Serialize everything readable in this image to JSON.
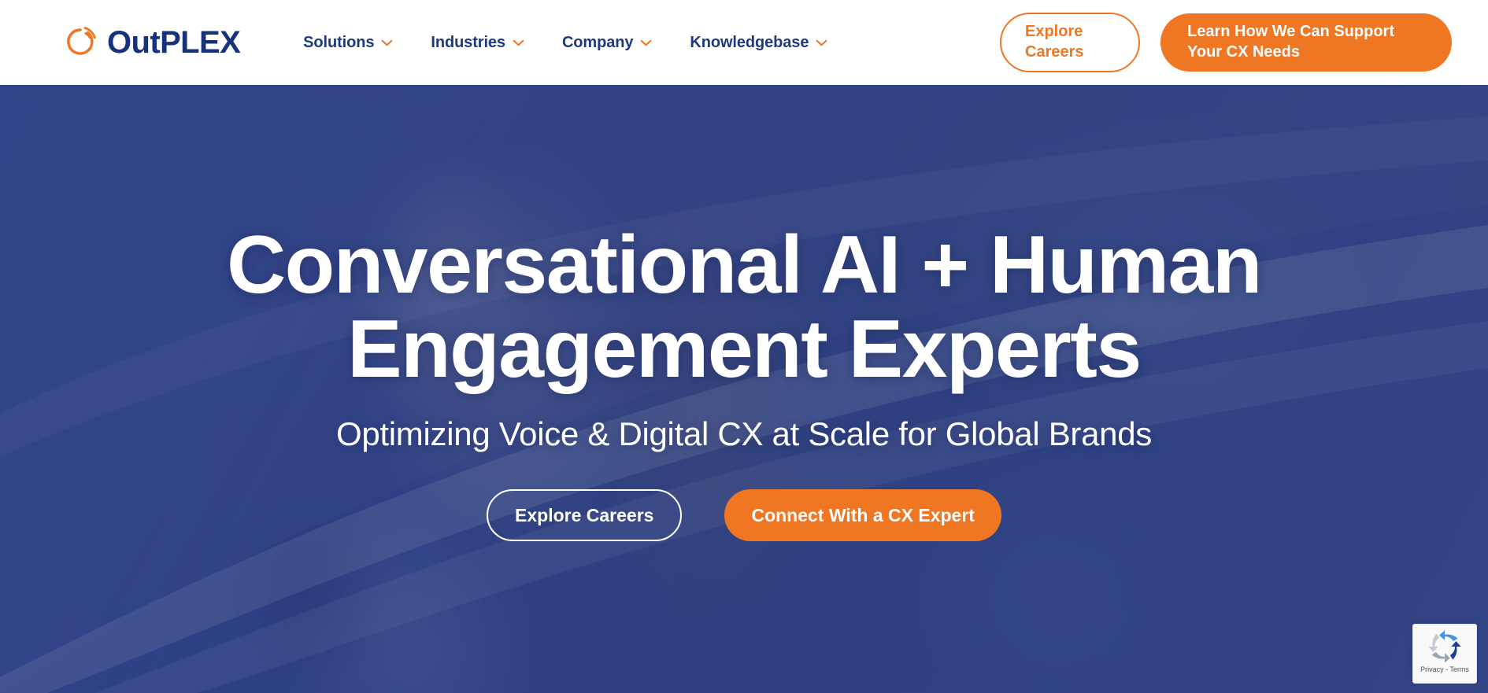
{
  "brand": {
    "logo_icon": "outplex-ring-icon",
    "name_light": "Out",
    "name_bold": "PLEX",
    "colors": {
      "orange": "#ef7622",
      "navy": "#16327a",
      "nav_navy": "#1d3a80",
      "hero_blue": "#394b86",
      "white": "#ffffff"
    }
  },
  "header": {
    "nav": [
      {
        "label": "Solutions",
        "icon": "chevron-down-icon"
      },
      {
        "label": "Industries",
        "icon": "chevron-down-icon"
      },
      {
        "label": "Company",
        "icon": "chevron-down-icon"
      },
      {
        "label": "Knowledgebase",
        "icon": "chevron-down-icon"
      }
    ],
    "cta_secondary": "Explore Careers",
    "cta_primary": "Learn How We Can Support Your CX Needs"
  },
  "hero": {
    "title_line1": "Conversational AI + Human",
    "title_line2": "Engagement Experts",
    "subtitle": "Optimizing Voice & Digital CX at Scale for Global Brands",
    "cta_secondary": "Explore Careers",
    "cta_primary": "Connect With a CX Expert"
  },
  "recaptcha": {
    "icon": "recaptcha-icon",
    "terms": "Privacy - Terms"
  }
}
